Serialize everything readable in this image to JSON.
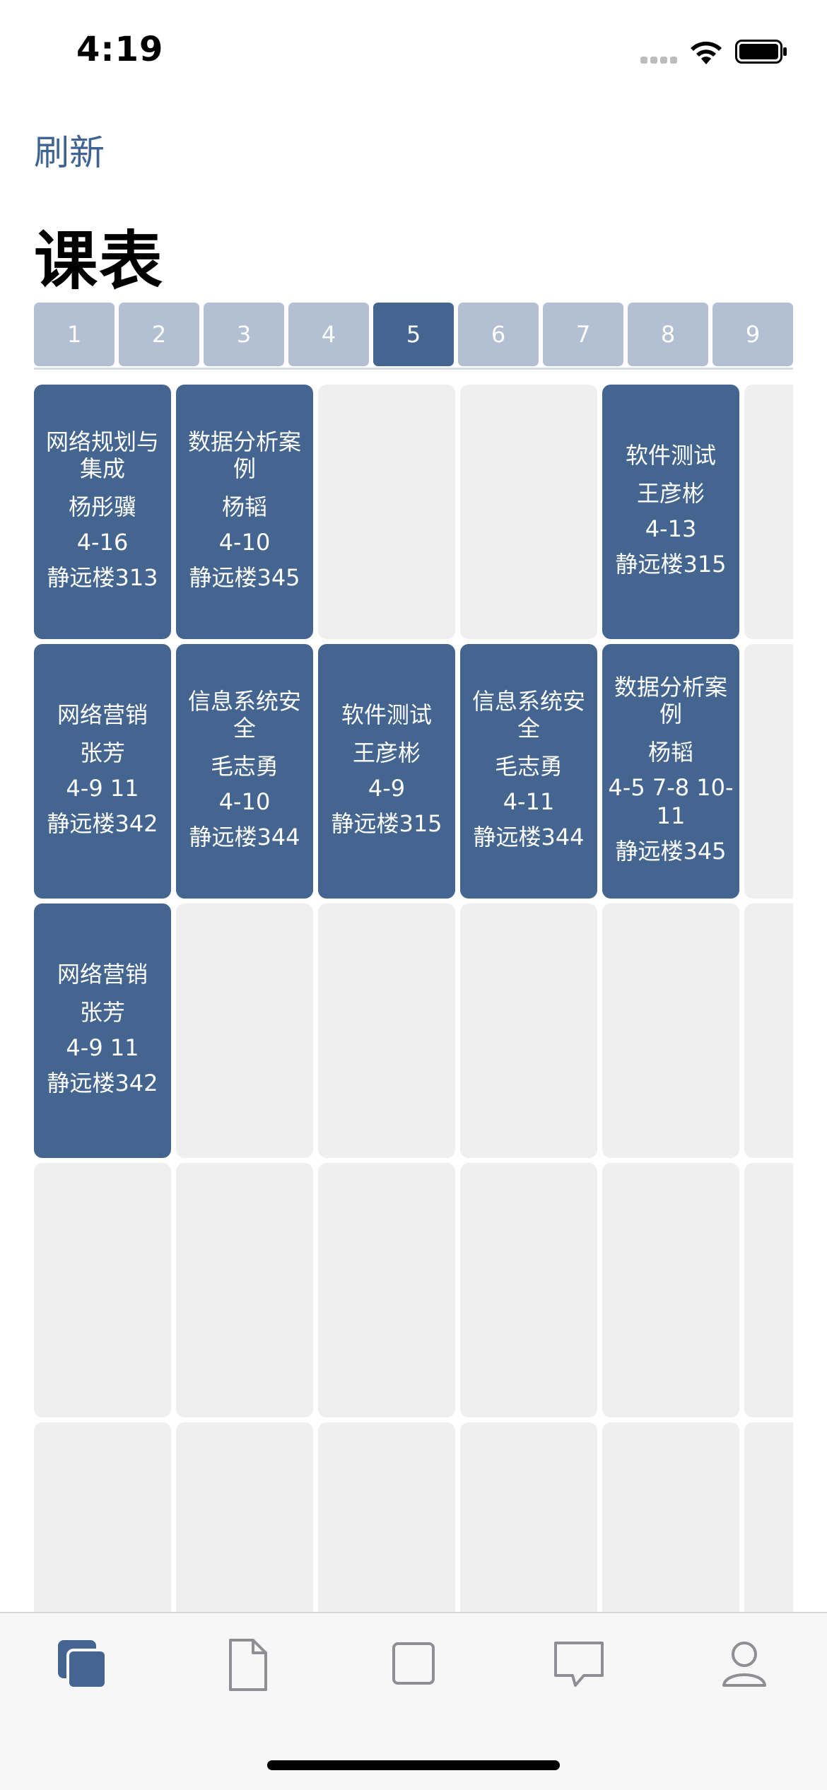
{
  "status_bar": {
    "time": "4:19"
  },
  "header": {
    "refresh_label": "刷新",
    "title": "课表"
  },
  "weeks": [
    "1",
    "2",
    "3",
    "4",
    "5",
    "6",
    "7",
    "8",
    "9"
  ],
  "active_week": "5",
  "schedule": {
    "row1": {
      "c1": {
        "name": "网络规划与集成",
        "teacher": "杨彤骥",
        "weeks": "4-16",
        "room": "静远楼313"
      },
      "c2": {
        "name": "数据分析案例",
        "teacher": "杨韬",
        "weeks": "4-10",
        "room": "静远楼345"
      },
      "c5": {
        "name": "软件测试",
        "teacher": "王彦彬",
        "weeks": "4-13",
        "room": "静远楼315"
      }
    },
    "row2": {
      "c1": {
        "name": "网络营销",
        "teacher": "张芳",
        "weeks": "4-9 11",
        "room": "静远楼342"
      },
      "c2": {
        "name": "信息系统安全",
        "teacher": "毛志勇",
        "weeks": "4-10",
        "room": "静远楼344"
      },
      "c3": {
        "name": "软件测试",
        "teacher": "王彦彬",
        "weeks": "4-9",
        "room": "静远楼315"
      },
      "c4": {
        "name": "信息系统安全",
        "teacher": "毛志勇",
        "weeks": "4-11",
        "room": "静远楼344"
      },
      "c5": {
        "name": "数据分析案例",
        "teacher": "杨韬",
        "weeks": "4-5 7-8 10-11",
        "room": "静远楼345"
      }
    },
    "row3": {
      "c1": {
        "name": "网络营销",
        "teacher": "张芳",
        "weeks": "4-9 11",
        "room": "静远楼342"
      }
    }
  },
  "tabs": [
    "schedule-icon",
    "document-icon",
    "square-icon",
    "message-icon",
    "person-icon"
  ],
  "colors": {
    "accent": "#43658f",
    "week_inactive": "#b3c0d3",
    "empty_cell": "#efefef"
  }
}
